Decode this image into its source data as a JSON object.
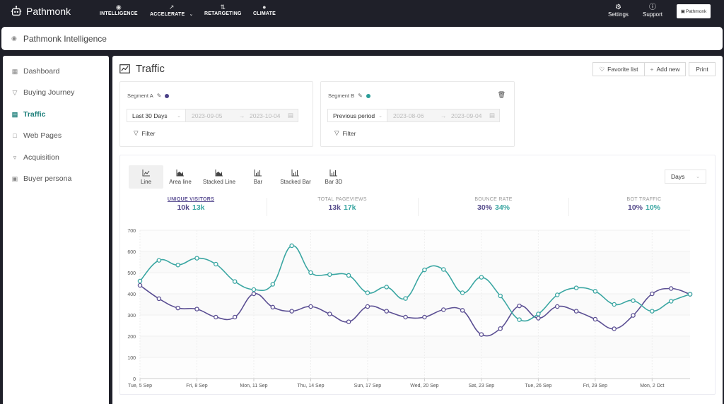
{
  "topnav": {
    "brand": "Pathmonk",
    "items": [
      {
        "label": "INTELLIGENCE",
        "icon": "intelligence-icon"
      },
      {
        "label": "ACCELERATE",
        "icon": "trend-icon",
        "dropdown": true
      },
      {
        "label": "RETARGETING",
        "icon": "repeat-icon"
      },
      {
        "label": "CLIMATE",
        "icon": "globe-icon"
      }
    ],
    "right": [
      {
        "label": "Settings",
        "icon": "gear-icon"
      },
      {
        "label": "Support",
        "icon": "help-icon"
      }
    ],
    "account_logo": "Pathmonk"
  },
  "subheader": {
    "title": "Pathmonk Intelligence"
  },
  "sidebar": {
    "items": [
      {
        "label": "Dashboard",
        "icon": "grid-icon",
        "active": false
      },
      {
        "label": "Buying Journey",
        "icon": "funnel-icon",
        "active": false
      },
      {
        "label": "Traffic",
        "icon": "line-chart-icon",
        "active": true
      },
      {
        "label": "Web Pages",
        "icon": "file-icon",
        "active": false
      },
      {
        "label": "Acquisition",
        "icon": "trophy-icon",
        "active": false
      },
      {
        "label": "Buyer persona",
        "icon": "id-card-icon",
        "active": false
      }
    ]
  },
  "page": {
    "title": "Traffic",
    "actions": {
      "favorite": "Favorite list",
      "add_new": "Add new",
      "print": "Print"
    }
  },
  "segments": [
    {
      "label": "Segment A",
      "color": "#4b4187",
      "period": "Last 30 Days",
      "start": "2023-09-05",
      "end": "2023-10-04",
      "filter": "Filter",
      "deletable": false
    },
    {
      "label": "Segment B",
      "color": "#2a9d98",
      "period": "Previous period",
      "start": "2023-08-06",
      "end": "2023-09-04",
      "filter": "Filter",
      "deletable": true
    }
  ],
  "chart_types": [
    {
      "label": "Line",
      "active": true
    },
    {
      "label": "Area line",
      "active": false
    },
    {
      "label": "Stacked Line",
      "active": false
    },
    {
      "label": "Bar",
      "active": false
    },
    {
      "label": "Stacked Bar",
      "active": false
    },
    {
      "label": "Bar 3D",
      "active": false
    }
  ],
  "granularity": "Days",
  "metrics": [
    {
      "label": "UNIQUE VISITORS",
      "a": "10k",
      "b": "13k",
      "active": true
    },
    {
      "label": "TOTAL PAGEVIEWS",
      "a": "13k",
      "b": "17k",
      "active": false
    },
    {
      "label": "BOUNCE RATE",
      "a": "30%",
      "b": "34%",
      "active": false
    },
    {
      "label": "BOT TRAFFIC",
      "a": "10%",
      "b": "10%",
      "active": false
    }
  ],
  "chart_data": {
    "type": "line",
    "title": "",
    "xlabel": "",
    "ylabel": "",
    "ylim": [
      0,
      700
    ],
    "yticks": [
      0,
      100,
      200,
      300,
      400,
      500,
      600,
      700
    ],
    "xtick_labels": [
      "Tue, 5 Sep",
      "Fri, 8 Sep",
      "Mon, 11 Sep",
      "Thu, 14 Sep",
      "Sun, 17 Sep",
      "Wed, 20 Sep",
      "Sat, 23 Sep",
      "Tue, 26 Sep",
      "Fri, 29 Sep",
      "Mon, 2 Oct"
    ],
    "xtick_every": 3,
    "num_points": 30,
    "grid": true,
    "legend": "none",
    "series": [
      {
        "name": "Segment A",
        "color": "#5b4f93",
        "values": [
          440,
          377,
          333,
          328,
          290,
          290,
          400,
          337,
          318,
          340,
          305,
          268,
          340,
          318,
          290,
          290,
          325,
          322,
          208,
          236,
          343,
          285,
          340,
          318,
          280,
          235,
          298,
          400,
          425,
          398
        ]
      },
      {
        "name": "Segment B",
        "color": "#3aa6a2",
        "values": [
          460,
          558,
          536,
          568,
          540,
          458,
          420,
          445,
          627,
          500,
          491,
          487,
          405,
          432,
          378,
          513,
          515,
          405,
          478,
          390,
          278,
          305,
          395,
          428,
          412,
          350,
          368,
          318,
          365,
          398
        ]
      }
    ]
  }
}
